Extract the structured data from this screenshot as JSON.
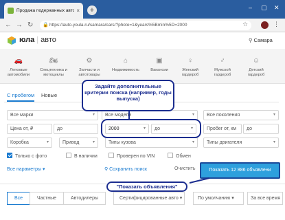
{
  "browser": {
    "tab_title": "Продажа подержанных автомо",
    "new_tab_label": "+",
    "url": "https://auto.youla.ru/samara/cars/?photo=1&years%5Bmin%5D=2000"
  },
  "site": {
    "brand": "юла",
    "brand_sub": "авто",
    "city": "Самара"
  },
  "categories": [
    {
      "icon": "car-icon",
      "glyph": "🚗",
      "label": "Легковые автомобили"
    },
    {
      "icon": "motorcycle-icon",
      "glyph": "🏍",
      "label": "Спецтехника и мотоциклы"
    },
    {
      "icon": "wrench-icon",
      "glyph": "⚙",
      "label": "Запчасти и автотовары"
    },
    {
      "icon": "house-icon",
      "glyph": "⌂",
      "label": "Недвижимость"
    },
    {
      "icon": "briefcase-icon",
      "glyph": "▣",
      "label": "Вакансии"
    },
    {
      "icon": "dress-icon",
      "glyph": "♀",
      "label": "Женский гардероб"
    },
    {
      "icon": "shirt-icon",
      "glyph": "♂",
      "label": "Мужской гардероб"
    },
    {
      "icon": "child-icon",
      "glyph": "☺",
      "label": "Детский гардероб"
    }
  ],
  "filter_tabs": {
    "used": "С пробегом",
    "new": "Новые"
  },
  "fields": {
    "make": "Все марки",
    "model": "Все модели",
    "generation": "Все поколения",
    "price_from": "Цена от, ₽",
    "price_to": "до",
    "year_from": "2000",
    "year_to": "до",
    "mileage_from": "Пробег от, км",
    "mileage_to": "до",
    "gearbox": "Коробка",
    "drive": "Привод",
    "body_types": "Типы кузова",
    "engine_types": "Типы двигателя"
  },
  "checkboxes": {
    "photo_only": "Только с фото",
    "in_stock": "В наличии",
    "vin_checked": "Проверен по VIN",
    "exchange": "Обмен"
  },
  "actions": {
    "all_params": "Все параметры",
    "save_search": "Сохранить поиск",
    "clear": "Очистить",
    "show": "Показать 12 886 объявлени"
  },
  "bottom_tabs": {
    "all": "Все",
    "private": "Частные",
    "dealers": "Автодилеры",
    "certified": "Сертифицированные авто",
    "sort": "По умолчанию",
    "period": "За все время"
  },
  "annotations": {
    "callout_filters": "Задайте дополнительные критерии поиска (например, годы выпуска)",
    "callout_show": "\"Показать объявления\""
  },
  "colors": {
    "accent": "#1a7bd0",
    "show_button": "#2ea0dd",
    "annotation": "#1b2d8f",
    "titlebar": "#2a5d9f"
  }
}
